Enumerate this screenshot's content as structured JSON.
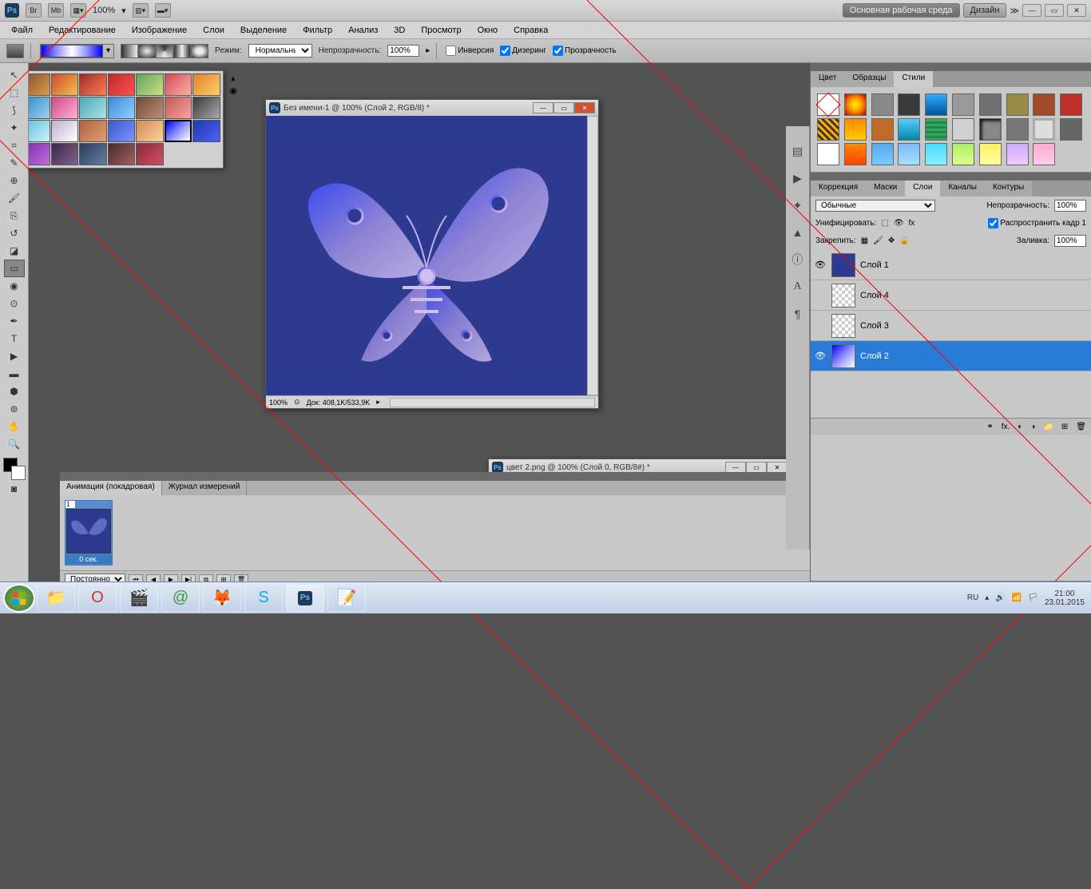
{
  "titlebar": {
    "zoom": "100%",
    "workspace_primary": "Основная рабочая среда",
    "workspace_design": "Дизайн"
  },
  "menu": {
    "file": "Файл",
    "edit": "Редактирование",
    "image": "Изображение",
    "layer": "Слои",
    "select": "Выделение",
    "filter": "Фильтр",
    "analysis": "Анализ",
    "threed": "3D",
    "view": "Просмотр",
    "window": "Окно",
    "help": "Справка"
  },
  "options": {
    "mode_label": "Режим:",
    "mode_value": "Нормальный",
    "opacity_label": "Непрозрачность:",
    "opacity_value": "100%",
    "inverse": "Инверсия",
    "dither": "Дизеринг",
    "transparency": "Прозрачность"
  },
  "doc1": {
    "title": "Без имени-1 @ 100% (Слой 2, RGB/8) *",
    "zoom": "100%",
    "docsize": "Док: 408,1K/533,9K"
  },
  "doc2": {
    "title": "цвет 2.png @ 100% (Слой 0, RGB/8#) *"
  },
  "animation": {
    "tab1": "Анимация (покадровая)",
    "tab2": "Журнал измерений",
    "frame_time": "0 сек.",
    "loop": "Постоянно"
  },
  "panels": {
    "color": "Цвет",
    "swatches": "Образцы",
    "styles": "Стили",
    "adjustments": "Коррекция",
    "masks": "Маски",
    "layers": "Слои",
    "channels": "Каналы",
    "paths": "Контуры"
  },
  "layers_panel": {
    "blend": "Обычные",
    "opacity_label": "Непрозрачность:",
    "opacity": "100%",
    "unify": "Унифицировать:",
    "propagate": "Распространить кадр 1",
    "lock": "Закрепить:",
    "fill_label": "Заливка:",
    "fill": "100%",
    "layers": [
      {
        "name": "Слой 1",
        "visible": true,
        "selected": false,
        "thumb": "butterfly"
      },
      {
        "name": "Слой 4",
        "visible": false,
        "selected": false,
        "thumb": "checker"
      },
      {
        "name": "Слой 3",
        "visible": false,
        "selected": false,
        "thumb": "checker"
      },
      {
        "name": "Слой 2",
        "visible": true,
        "selected": true,
        "thumb": "gradient"
      }
    ]
  },
  "taskbar": {
    "lang": "RU",
    "time": "21:00",
    "date": "23.01.2015"
  }
}
